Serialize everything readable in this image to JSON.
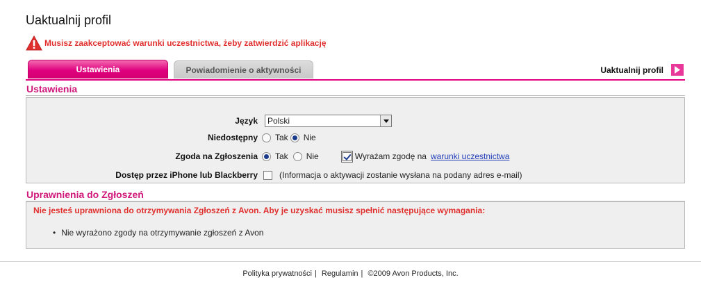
{
  "page": {
    "title": "Uaktualnij profil"
  },
  "warning": {
    "text": "Musisz zaakceptować warunki uczestnictwa, żeby zatwierdzić aplikację",
    "icon": "warning-triangle-icon",
    "color": "#e0302e"
  },
  "tabs": [
    {
      "label": "Ustawienia",
      "active": true
    },
    {
      "label": "Powiadomienie o aktywności",
      "active": false
    }
  ],
  "update_action": {
    "label": "Uaktualnij profil",
    "icon": "arrow-right-icon"
  },
  "accent_color": "#e0007f",
  "settings": {
    "title": "Ustawienia",
    "language": {
      "label": "Język",
      "value": "Polski"
    },
    "unavailable": {
      "label": "Niedostępny",
      "yes": "Tak",
      "no": "Nie",
      "selected": "no"
    },
    "notifications_consent": {
      "label": "Zgoda na Zgłoszenia",
      "yes": "Tak",
      "no": "Nie",
      "selected": "yes",
      "terms_checkbox_label": "Wyrażam zgodę na",
      "terms_checked": true,
      "terms_link": "warunki uczestnictwa"
    },
    "mobile_access": {
      "label": "Dostęp przez iPhone lub Blackberry",
      "checked": false,
      "note": "(Informacja o aktywacji zostanie wysłana na podany adres e-mail)"
    }
  },
  "permissions": {
    "title": "Uprawnienia do Zgłoszeń",
    "warning": "Nie jesteś uprawniona do otrzymywania Zgłoszeń z Avon. Aby je uzyskać musisz spełnić następujące wymagania:",
    "items": [
      "Nie wyrażono zgody na otrzymywanie zgłoszeń z Avon"
    ]
  },
  "footer": {
    "privacy": "Polityka prywatności",
    "terms": "Regulamin",
    "copyright": "©2009 Avon Products, Inc."
  }
}
